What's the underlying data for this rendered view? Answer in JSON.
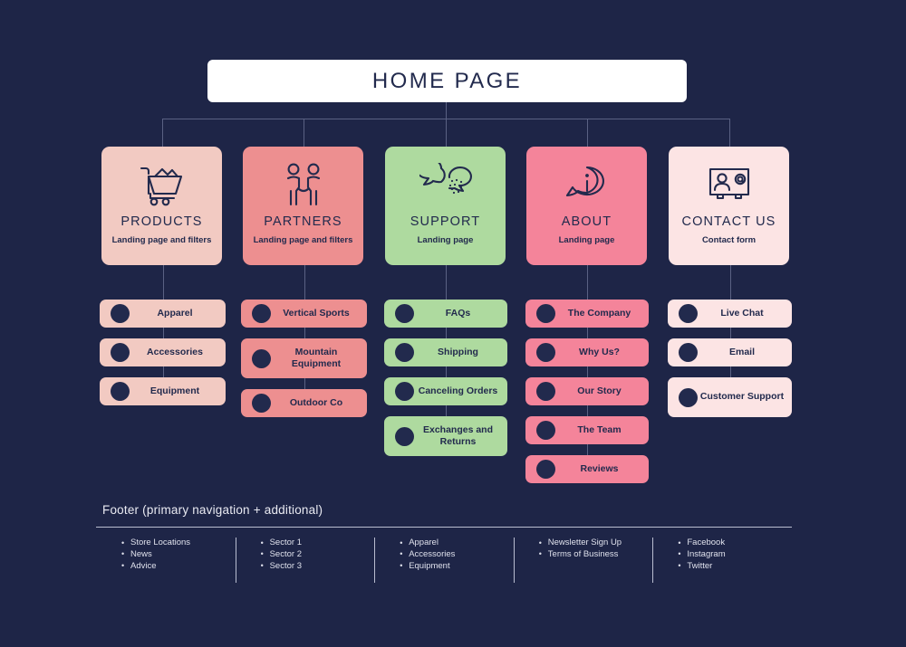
{
  "background_color": "#1e2547",
  "home": {
    "label": "HOME PAGE",
    "bg": "#ffffff"
  },
  "categories": [
    {
      "id": "products",
      "title": "PRODUCTS",
      "subtitle": "Landing page and filters",
      "color": "#f2cac2",
      "icon": "shopping-cart-icon",
      "children": [
        {
          "label": "Apparel",
          "lines": 1
        },
        {
          "label": "Accessories",
          "lines": 1
        },
        {
          "label": "Equipment",
          "lines": 1
        }
      ]
    },
    {
      "id": "partners",
      "title": "PARTNERS",
      "subtitle": "Landing page and filters",
      "color": "#ed8f90",
      "icon": "handshake-icon",
      "children": [
        {
          "label": "Vertical Sports",
          "lines": 1
        },
        {
          "label": "Mountain Equipment",
          "lines": 2
        },
        {
          "label": "Outdoor Co",
          "lines": 1
        }
      ]
    },
    {
      "id": "support",
      "title": "SUPPORT",
      "subtitle": "Landing page",
      "color": "#aeda9f",
      "icon": "chat-bubbles-icon",
      "children": [
        {
          "label": "FAQs",
          "lines": 1
        },
        {
          "label": "Shipping",
          "lines": 1
        },
        {
          "label": "Canceling Orders",
          "lines": 1
        },
        {
          "label": "Exchanges and Returns",
          "lines": 2
        }
      ]
    },
    {
      "id": "about",
      "title": "ABOUT",
      "subtitle": "Landing page",
      "color": "#f4849a",
      "icon": "info-bubble-icon",
      "children": [
        {
          "label": "The Company",
          "lines": 1
        },
        {
          "label": "Why Us?",
          "lines": 1
        },
        {
          "label": "Our Story",
          "lines": 1
        },
        {
          "label": "The Team",
          "lines": 1
        },
        {
          "label": "Reviews",
          "lines": 1
        }
      ]
    },
    {
      "id": "contact-us",
      "title": "CONTACT US",
      "subtitle": "Contact form",
      "color": "#fce4e4",
      "icon": "contact-card-icon",
      "children": [
        {
          "label": "Live Chat",
          "lines": 1
        },
        {
          "label": "Email",
          "lines": 1
        },
        {
          "label": "Customer Support",
          "lines": 2
        }
      ]
    }
  ],
  "footer": {
    "title": "Footer (primary navigation + additional)",
    "columns": [
      {
        "items": [
          "Store Locations",
          "News",
          "Advice"
        ]
      },
      {
        "items": [
          "Sector 1",
          "Sector 2",
          "Sector 3"
        ]
      },
      {
        "items": [
          "Apparel",
          "Accessories",
          "Equipment"
        ]
      },
      {
        "items": [
          "Newsletter Sign Up",
          "Terms of Business"
        ]
      },
      {
        "items": [
          "Facebook",
          "Instagram",
          "Twitter"
        ]
      }
    ]
  }
}
